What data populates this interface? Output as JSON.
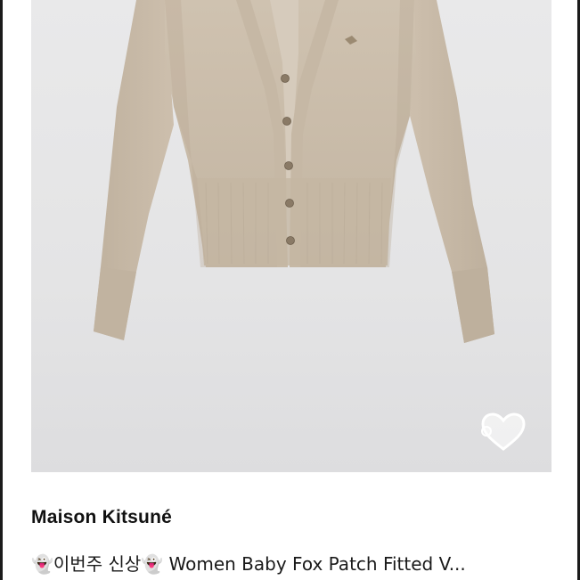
{
  "listing": {
    "photo_alt": "",
    "brand": "Maison Kitsuné",
    "title": "👻이번주 신상👻 Women Baby Fox Patch Fitted V...",
    "wishlist_icon": "heart-icon",
    "colors": {
      "knit": "#c9bba8",
      "background": "#e6e6e7",
      "text": "#111111"
    }
  }
}
